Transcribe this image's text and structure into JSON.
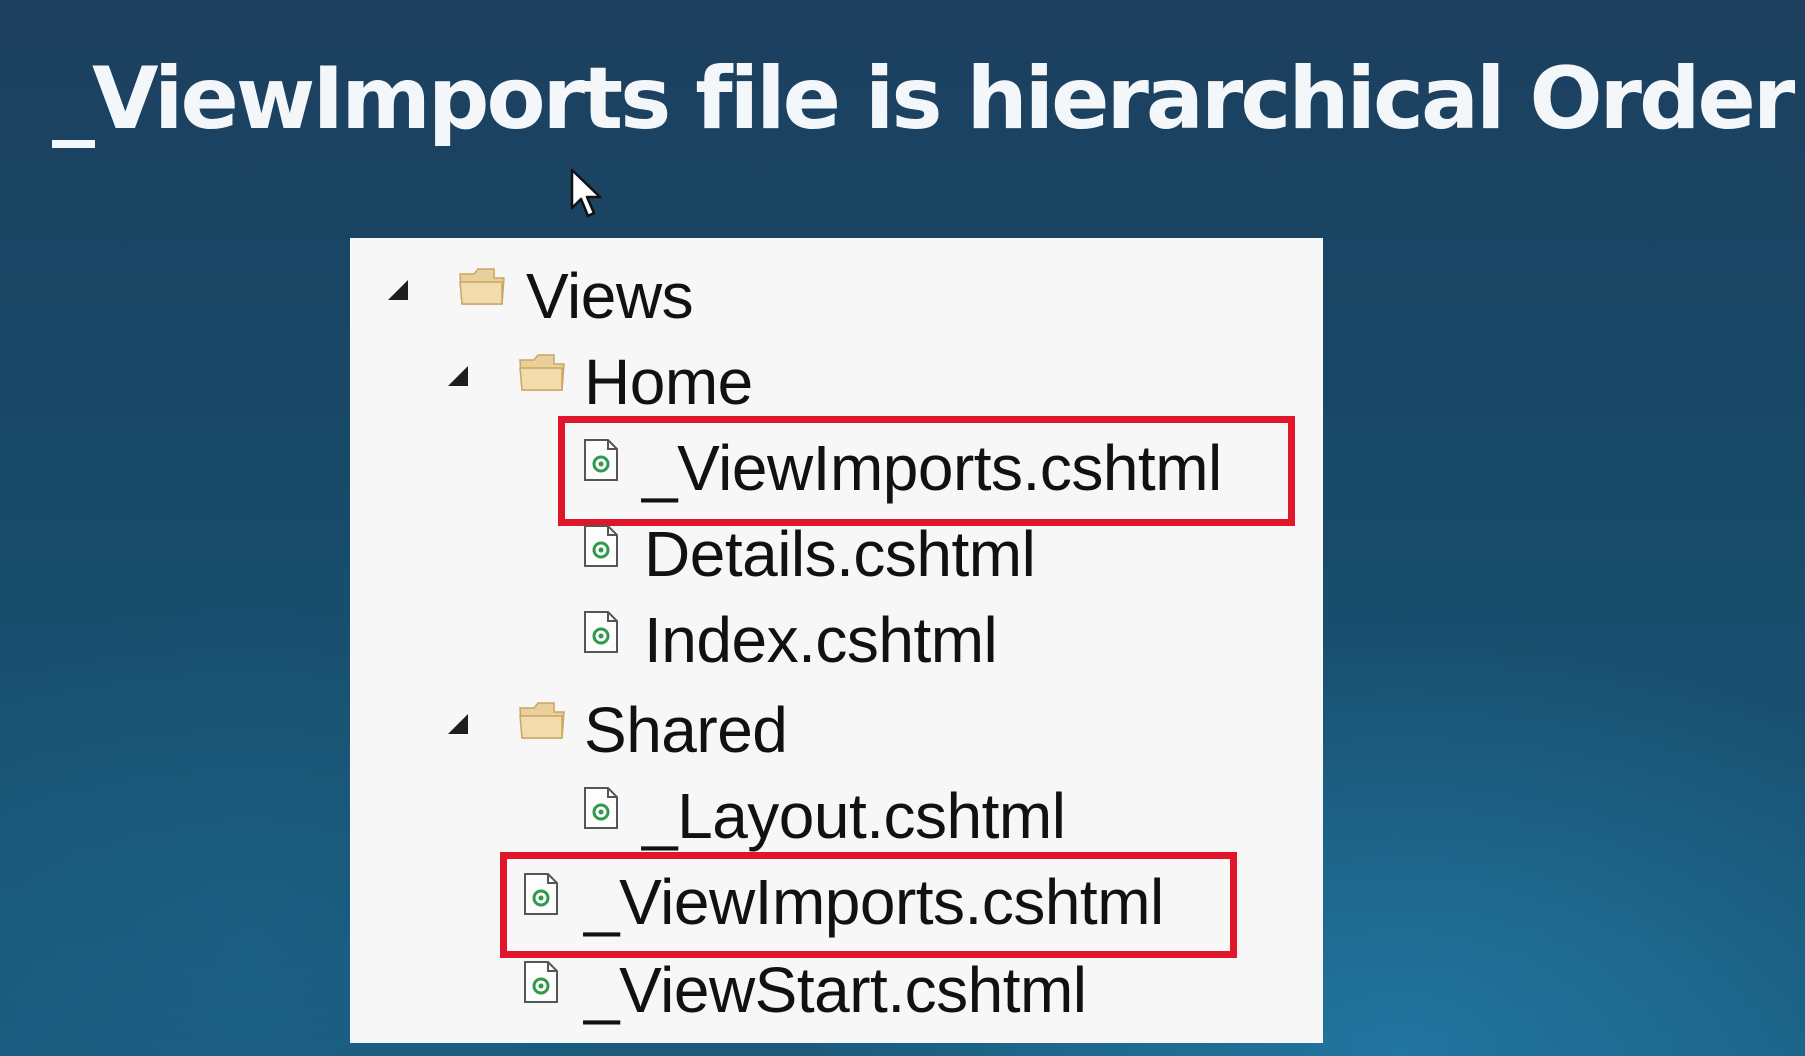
{
  "slide": {
    "title": "_ViewImports file is hierarchical Order"
  },
  "tree": {
    "views": {
      "label": "Views",
      "icon": "folder-icon"
    },
    "home": {
      "label": "Home",
      "icon": "folder-icon"
    },
    "home_viewimports": {
      "label": "_ViewImports.cshtml",
      "icon": "cshtml-file-icon",
      "highlighted": true
    },
    "details": {
      "label": "Details.cshtml",
      "icon": "cshtml-file-icon"
    },
    "index": {
      "label": "Index.cshtml",
      "icon": "cshtml-file-icon"
    },
    "shared": {
      "label": "Shared",
      "icon": "folder-icon"
    },
    "layout": {
      "label": "_Layout.cshtml",
      "icon": "cshtml-file-icon"
    },
    "views_viewimports": {
      "label": "_ViewImports.cshtml",
      "icon": "cshtml-file-icon",
      "highlighted": true
    },
    "viewstart": {
      "label": "_ViewStart.cshtml",
      "icon": "cshtml-file-icon"
    }
  },
  "colors": {
    "highlight": "#e0162b",
    "folder": "#e3c48a",
    "file_accent": "#2f9a4a"
  }
}
